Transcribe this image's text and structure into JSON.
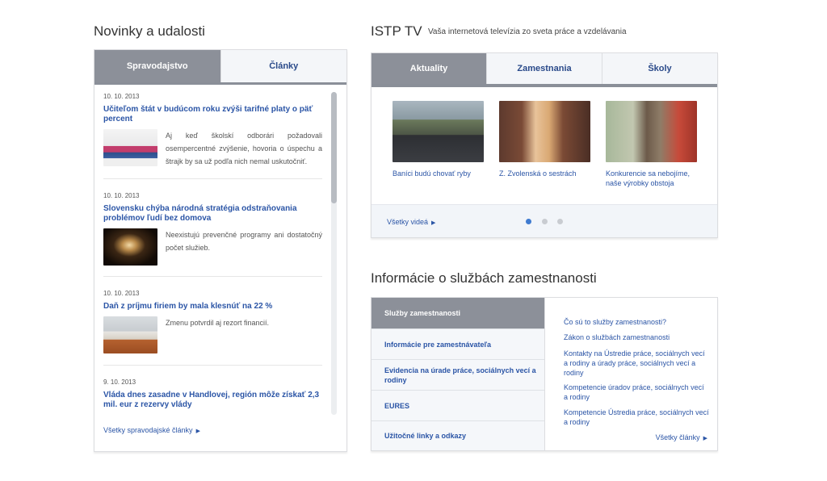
{
  "news": {
    "heading": "Novinky a udalosti",
    "tabs": [
      "Spravodajstvo",
      "Články"
    ],
    "items": [
      {
        "date": "10. 10. 2013",
        "title": "Učiteľom štát v budúcom roku zvýši tarifné platy o päť percent",
        "text": "Aj keď školskí odborári požadovali osempercentné zvýšenie, hovoria o úspechu a štrajk by sa už podľa nich nemal uskutočniť."
      },
      {
        "date": "10. 10. 2013",
        "title": "Slovensku chýba národná stratégia odstraňovania problémov ľudí bez domova",
        "text": "Neexistujú prevenčné programy ani dostatočný počet služieb."
      },
      {
        "date": "10. 10. 2013",
        "title": "Daň z príjmu firiem by mala klesnúť na 22 %",
        "text": "Zmenu potvrdil aj rezort financií."
      },
      {
        "date": "9. 10. 2013",
        "title": "Vláda dnes zasadne v Handlovej, región môže získať 2,3 mil. eur z rezervy vlády",
        "text": ""
      }
    ],
    "footer": "Všetky spravodajské články",
    "arrow": "▶"
  },
  "tv": {
    "heading": "ISTP TV",
    "subtitle": "Vaša internetová televízia zo sveta práce a vzdelávania",
    "tabs": [
      "Aktuality",
      "Zamestnania",
      "Školy"
    ],
    "videos": [
      {
        "caption": "Baníci budú chovať ryby"
      },
      {
        "caption": "Z. Zvolenská o sestrách"
      },
      {
        "caption": "Konkurencie sa nebojíme, naše výrobky obstoja"
      }
    ],
    "footer": "Všetky videá",
    "arrow": "▶"
  },
  "info": {
    "heading": "Informácie o službách zamestnanosti",
    "menu": [
      "Služby zamestnanosti",
      "Informácie pre zamestnávateľa",
      "Evidencia na úrade práce, sociálnych vecí a rodiny",
      "EURES",
      "Užitočné linky a odkazy"
    ],
    "links": [
      "Čo sú to služby zamestnanosti?",
      "Zákon o službách zamestnanosti",
      "Kontakty na Ústredie práce, sociálnych vecí a rodiny a úrady práce, sociálnych vecí a rodiny",
      "Kompetencie úradov práce, sociálnych vecí a rodiny",
      "Kompetencie Ústredia práce, sociálnych vecí a rodiny"
    ],
    "more": "Všetky články",
    "arrow": "▶"
  },
  "colors": {
    "accent_link": "#2b55a6",
    "active_tab": "#8c9099",
    "carousel_active": "#3f7bd0"
  }
}
